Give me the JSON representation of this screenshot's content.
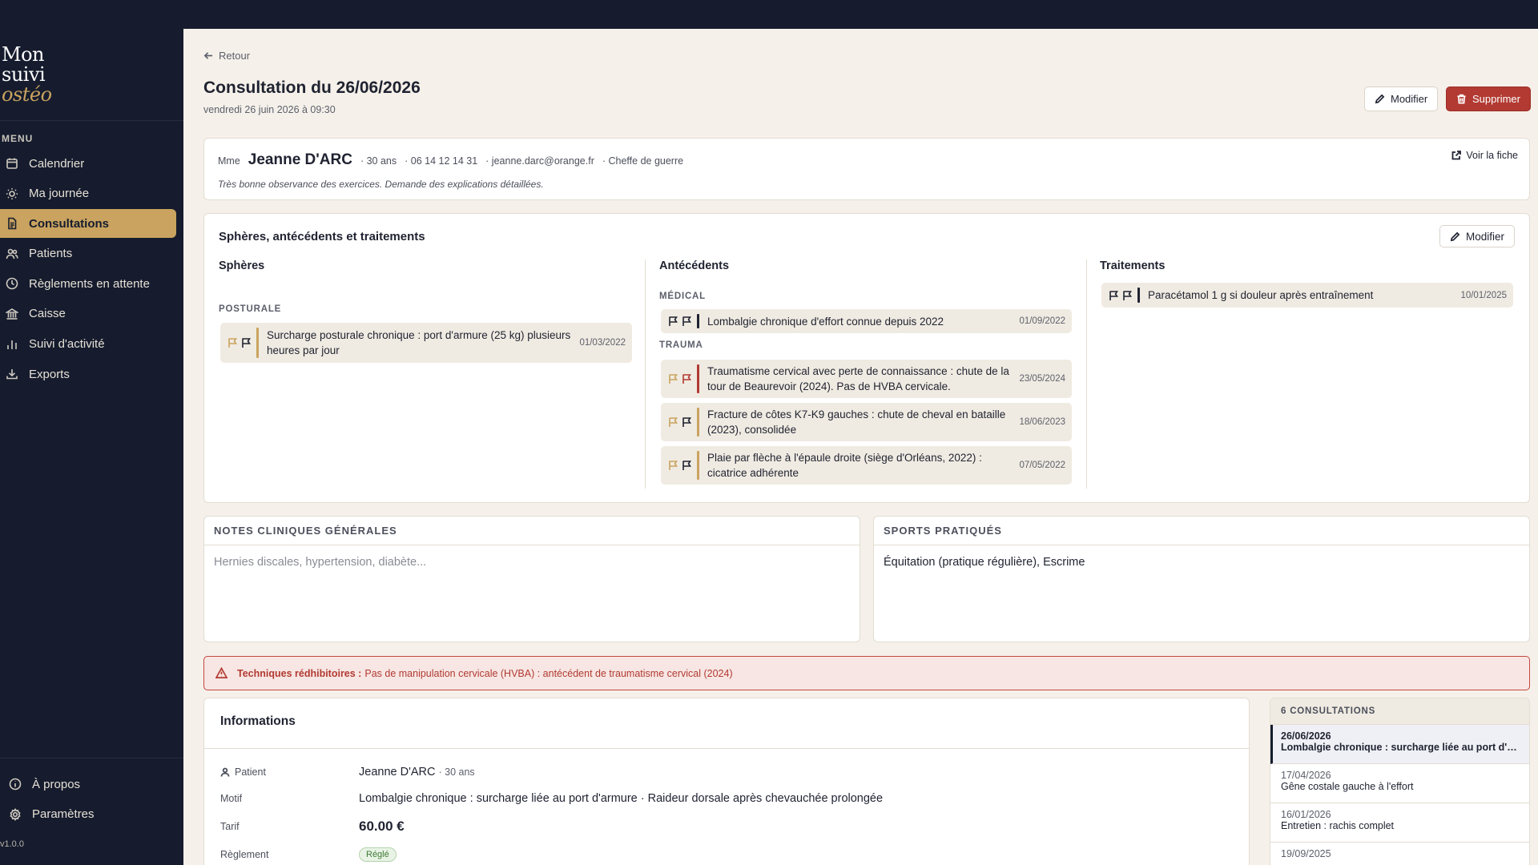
{
  "sidebar": {
    "logo_line1": "Mon",
    "logo_line2": "suivi",
    "logo_line3": "ostéo",
    "menu_label": "MENU",
    "items": [
      {
        "label": "Calendrier",
        "icon": "calendar-icon"
      },
      {
        "label": "Ma journée",
        "icon": "sun-icon"
      },
      {
        "label": "Consultations",
        "icon": "document-icon"
      },
      {
        "label": "Patients",
        "icon": "users-icon"
      },
      {
        "label": "Règlements en attente",
        "icon": "clock-icon"
      },
      {
        "label": "Caisse",
        "icon": "bank-icon"
      },
      {
        "label": "Suivi d'activité",
        "icon": "bar-chart-icon"
      },
      {
        "label": "Exports",
        "icon": "download-icon"
      }
    ],
    "active_item": "Consultations",
    "bottom_items": [
      {
        "label": "À propos",
        "icon": "info-icon"
      },
      {
        "label": "Paramètres",
        "icon": "gear-icon"
      }
    ],
    "version": "v1.0.0"
  },
  "header": {
    "back_label": "Retour",
    "title": "Consultation du 26/06/2026",
    "subtitle": "vendredi 26 juin 2026 à 09:30",
    "modify_label": "Modifier",
    "delete_label": "Supprimer"
  },
  "patient": {
    "civility": "Mme",
    "name": "Jeanne D'ARC",
    "age": "· 30 ans",
    "phone": "· 06 14 12 14 31",
    "email": "· jeanne.darc@orange.fr",
    "job": "· Cheffe de guerre",
    "note": "Très bonne observance des exercices. Demande des explications détaillées.",
    "voir_fiche": "Voir la fiche"
  },
  "history": {
    "title": "Sphères, antécédents et traitements",
    "modify_label": "Modifier",
    "spheres": {
      "title": "Sphères",
      "category": "POSTURALE",
      "items": [
        {
          "text": "Surcharge posturale chronique : port d'armure (25 kg) plusieurs heures par jour",
          "date": "01/03/2022"
        }
      ]
    },
    "antecedents": {
      "title": "Antécédents",
      "medical_label": "MÉDICAL",
      "medical": [
        {
          "text": "Lombalgie chronique d'effort connue depuis 2022",
          "date": "01/09/2022"
        }
      ],
      "trauma_label": "TRAUMA",
      "trauma": [
        {
          "text": "Traumatisme cervical avec perte de connaissance : chute de la tour de Beaurevoir (2024). Pas de HVBA cervicale.",
          "date": "23/05/2024"
        },
        {
          "text": "Fracture de côtes K7-K9 gauches : chute de cheval en bataille (2023), consolidée",
          "date": "18/06/2023"
        },
        {
          "text": "Plaie par flèche à l'épaule droite (siège d'Orléans, 2022) : cicatrice adhérente",
          "date": "07/05/2022"
        }
      ]
    },
    "traitements": {
      "title": "Traitements",
      "items": [
        {
          "text": "Paracétamol 1 g si douleur après entraînement",
          "date": "10/01/2025"
        }
      ]
    }
  },
  "notes": {
    "title": "NOTES CLINIQUES GÉNÉRALES",
    "placeholder": "Hernies discales, hypertension, diabète..."
  },
  "sports": {
    "title": "SPORTS PRATIQUÉS",
    "value": "Équitation (pratique régulière), Escrime"
  },
  "alert": {
    "label": "Techniques rédhibitoires :",
    "text": "Pas de manipulation cervicale (HVBA) : antécédent de traumatisme cervical (2024)"
  },
  "info": {
    "title": "Informations",
    "patient_label": "Patient",
    "patient_value": "Jeanne D'ARC",
    "patient_age": "· 30 ans",
    "motif_label": "Motif",
    "motif_value": "Lombalgie chronique : surcharge liée au port d'armure · Raideur dorsale après chevauchée prolongée",
    "tarif_label": "Tarif",
    "tarif_value": "60.00 €",
    "reglement_label": "Règlement",
    "reglement_value": "Réglé"
  },
  "consultations": {
    "header": "6 CONSULTATIONS",
    "items": [
      {
        "date": "26/06/2026",
        "motif": "Lombalgie chronique : surcharge liée au port d'armure"
      },
      {
        "date": "17/04/2026",
        "motif": "Gêne costale gauche à l'effort"
      },
      {
        "date": "16/01/2026",
        "motif": "Entretien : rachis complet"
      },
      {
        "date": "19/09/2025",
        "motif": ""
      }
    ]
  },
  "colors": {
    "sidebar_bg": "#161c2e",
    "accent": "#c9a35f",
    "danger": "#b23a32",
    "page_bg": "#f5f1ea"
  }
}
